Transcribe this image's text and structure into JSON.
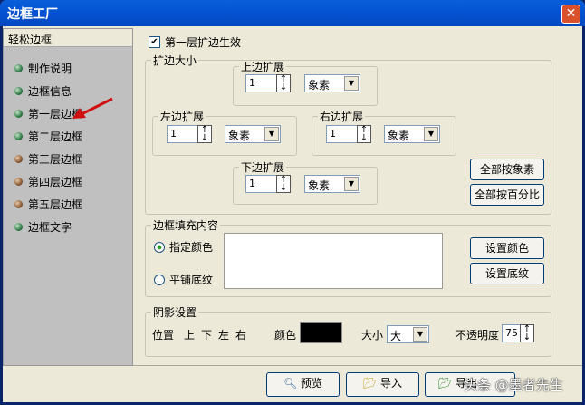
{
  "window": {
    "title": "边框工厂",
    "close": "✕"
  },
  "sidebar": {
    "header": "轻松边框",
    "items": [
      {
        "label": "制作说明",
        "color": "green"
      },
      {
        "label": "边框信息",
        "color": "green"
      },
      {
        "label": "第一层边框",
        "color": "green"
      },
      {
        "label": "第二层边框",
        "color": "green"
      },
      {
        "label": "第三层边框",
        "color": "brown"
      },
      {
        "label": "第四层边框",
        "color": "brown"
      },
      {
        "label": "第五层边框",
        "color": "brown"
      },
      {
        "label": "边框文字",
        "color": "green"
      }
    ]
  },
  "enable": {
    "label": "第一层扩边生效",
    "checked": true
  },
  "expand": {
    "title": "扩边大小",
    "top": {
      "label": "上边扩展",
      "value": "1",
      "unit": "象素"
    },
    "left": {
      "label": "左边扩展",
      "value": "1",
      "unit": "象素"
    },
    "right": {
      "label": "右边扩展",
      "value": "1",
      "unit": "象素"
    },
    "bottom": {
      "label": "下边扩展",
      "value": "1",
      "unit": "象素"
    },
    "all_pixel": "全部按象素",
    "all_percent": "全部按百分比"
  },
  "fill": {
    "title": "边框填充内容",
    "opt_color": "指定颜色",
    "opt_texture": "平铺底纹",
    "set_color": "设置颜色",
    "set_texture": "设置底纹"
  },
  "shadow": {
    "title": "阴影设置",
    "position_label": "位置",
    "positions": [
      "上",
      "下",
      "左",
      "右"
    ],
    "color_label": "颜色",
    "color": "#000000",
    "size_label": "大小",
    "size": "大",
    "opacity_label": "不透明度",
    "opacity": "75"
  },
  "footer": {
    "preview": "预览",
    "import": "导入",
    "export": "导出",
    "watermark": "头条 @墨者先生"
  }
}
